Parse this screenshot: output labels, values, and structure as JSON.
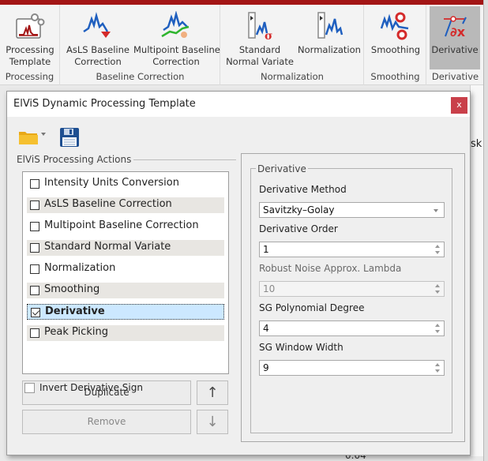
{
  "ribbon": {
    "groups": [
      {
        "label": "Processing",
        "buttons": [
          {
            "label_line1": "Processing",
            "label_line2": "Template",
            "icon": "processing-template-icon"
          }
        ]
      },
      {
        "label": "Baseline Correction",
        "buttons": [
          {
            "label_line1": "AsLS Baseline",
            "label_line2": "Correction",
            "icon": "asls-baseline-icon"
          },
          {
            "label_line1": "Multipoint Baseline",
            "label_line2": "Correction",
            "icon": "multipoint-baseline-icon"
          }
        ]
      },
      {
        "label": "Normalization",
        "buttons": [
          {
            "label_line1": "Standard",
            "label_line2": "Normal Variate",
            "icon": "snv-icon"
          },
          {
            "label_line1": "Normalization",
            "label_line2": "",
            "icon": "normalization-icon"
          }
        ]
      },
      {
        "label": "Smoothing",
        "buttons": [
          {
            "label_line1": "Smoothing",
            "label_line2": "",
            "icon": "smoothing-icon"
          }
        ]
      },
      {
        "label": "Derivative",
        "buttons": [
          {
            "label_line1": "Derivative",
            "label_line2": "",
            "icon": "derivative-icon",
            "active": true
          }
        ]
      }
    ]
  },
  "background": {
    "partial_text": "sk",
    "partial_number": "0.04"
  },
  "dialog": {
    "title": "ElViS Dynamic Processing Template",
    "close_label": "x",
    "actions_group_label": "ElViS Processing Actions",
    "actions": [
      {
        "label": "Intensity Units Conversion",
        "checked": false
      },
      {
        "label": "AsLS Baseline Correction",
        "checked": false
      },
      {
        "label": "Multipoint Baseline Correction",
        "checked": false
      },
      {
        "label": "Standard Normal Variate",
        "checked": false
      },
      {
        "label": "Normalization",
        "checked": false
      },
      {
        "label": "Smoothing",
        "checked": false
      },
      {
        "label": "Derivative",
        "checked": true,
        "selected": true
      },
      {
        "label": "Peak Picking",
        "checked": false
      }
    ],
    "buttons": {
      "duplicate": "Duplicate",
      "remove": "Remove",
      "move_up": "↑",
      "move_down": "↓"
    },
    "settings": {
      "group_title": "Derivative",
      "method_label": "Derivative Method",
      "method_value": "Savitzky–Golay",
      "order_label": "Derivative Order",
      "order_value": "1",
      "lambda_label": "Robust Noise Approx. Lambda",
      "lambda_value": "10",
      "poly_label": "SG Polynomial Degree",
      "poly_value": "4",
      "window_label": "SG Window Width",
      "window_value": "9",
      "invert_label": "Invert Derivative Sign",
      "invert_checked": false
    }
  },
  "colors": {
    "accent_red": "#a31515",
    "close_red": "#c9404a",
    "selection_blue": "#cce8ff",
    "icon_blue": "#1f5fbf",
    "icon_red": "#d42a2a"
  }
}
